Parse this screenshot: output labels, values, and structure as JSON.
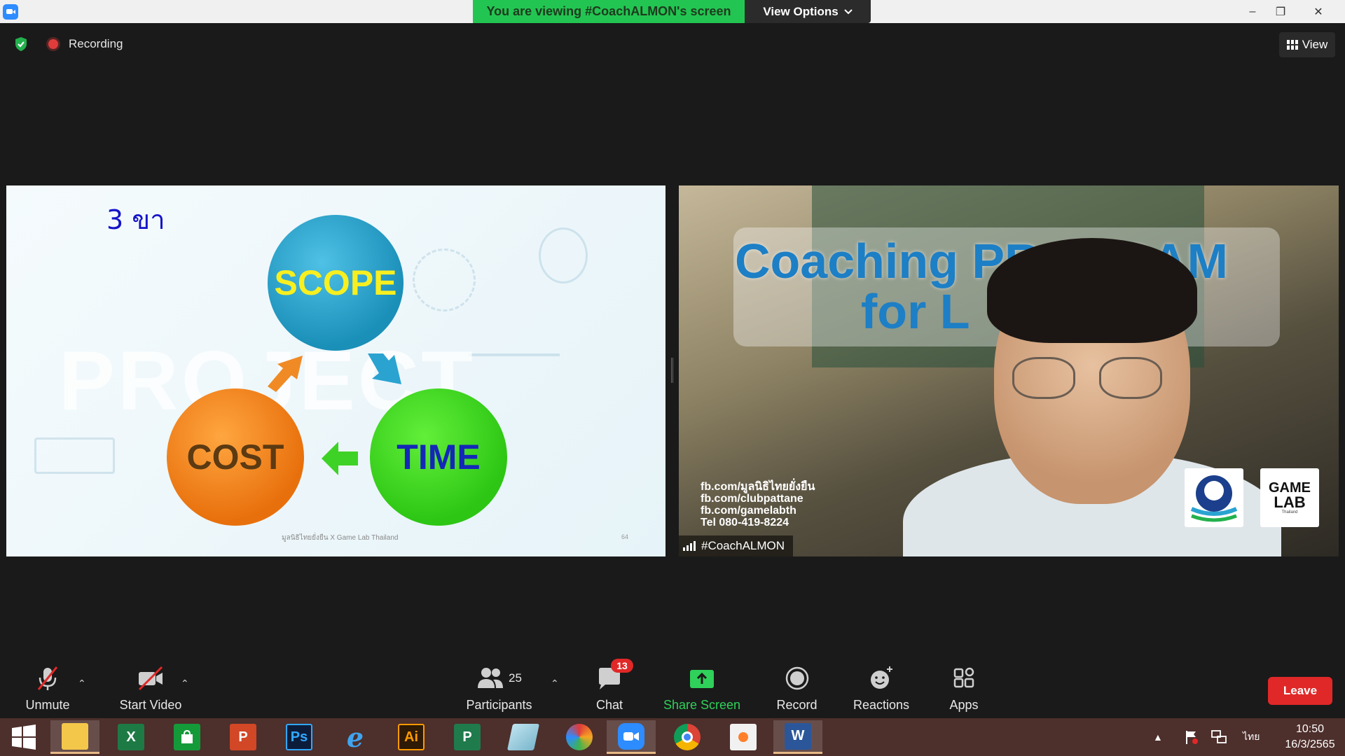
{
  "titlebar": {
    "banner": "You are viewing #CoachALMON's screen",
    "view_options": "View Options",
    "minimize": "–",
    "restore": "❐",
    "close": "✕"
  },
  "meeting": {
    "recording_label": "Recording",
    "view_label": "View"
  },
  "slide": {
    "title": "3 ขา",
    "background_word": "PROJECT",
    "circles": {
      "scope": "SCOPE",
      "cost": "COST",
      "time": "TIME"
    },
    "footer": "มูลนิธิไทยยั่งยืน X Game Lab Thailand",
    "page_number": "64",
    "colors": {
      "scope": "#1a8fb8",
      "cost": "#e8700c",
      "time": "#2dc614",
      "title": "#1414c8"
    }
  },
  "camera": {
    "banner_line1": "Coaching PROGRAM",
    "banner_line2": "for L",
    "contacts": [
      "fb.com/มูลนิธิไทยยั่งยืน",
      "fb.com/clubpattane",
      "fb.com/gamelabth",
      "Tel 080-419-8224"
    ],
    "logo_game": "GAME",
    "logo_lab": "LAB",
    "logo_sub": "Thailand",
    "participant_name": "#CoachALMON"
  },
  "toolbar": {
    "unmute": "Unmute",
    "start_video": "Start Video",
    "participants": "Participants",
    "participants_count": "25",
    "chat": "Chat",
    "chat_badge": "13",
    "share_screen": "Share Screen",
    "record": "Record",
    "reactions": "Reactions",
    "apps": "Apps",
    "leave": "Leave",
    "accent_green": "#2fd15a",
    "leave_red": "#e02828"
  },
  "taskbar": {
    "apps": [
      {
        "name": "file-explorer",
        "label": ""
      },
      {
        "name": "excel",
        "label": "X"
      },
      {
        "name": "store",
        "label": ""
      },
      {
        "name": "powerpoint",
        "label": "P"
      },
      {
        "name": "photoshop",
        "label": "Ps"
      },
      {
        "name": "internet-explorer",
        "label": "e"
      },
      {
        "name": "illustrator",
        "label": "Ai"
      },
      {
        "name": "project",
        "label": "P"
      },
      {
        "name": "notes",
        "label": ""
      },
      {
        "name": "photoscape",
        "label": ""
      },
      {
        "name": "zoom",
        "label": ""
      },
      {
        "name": "chrome",
        "label": ""
      },
      {
        "name": "paint",
        "label": ""
      },
      {
        "name": "word",
        "label": "W"
      }
    ],
    "language": "ไทย",
    "time": "10:50",
    "date": "16/3/2565"
  }
}
